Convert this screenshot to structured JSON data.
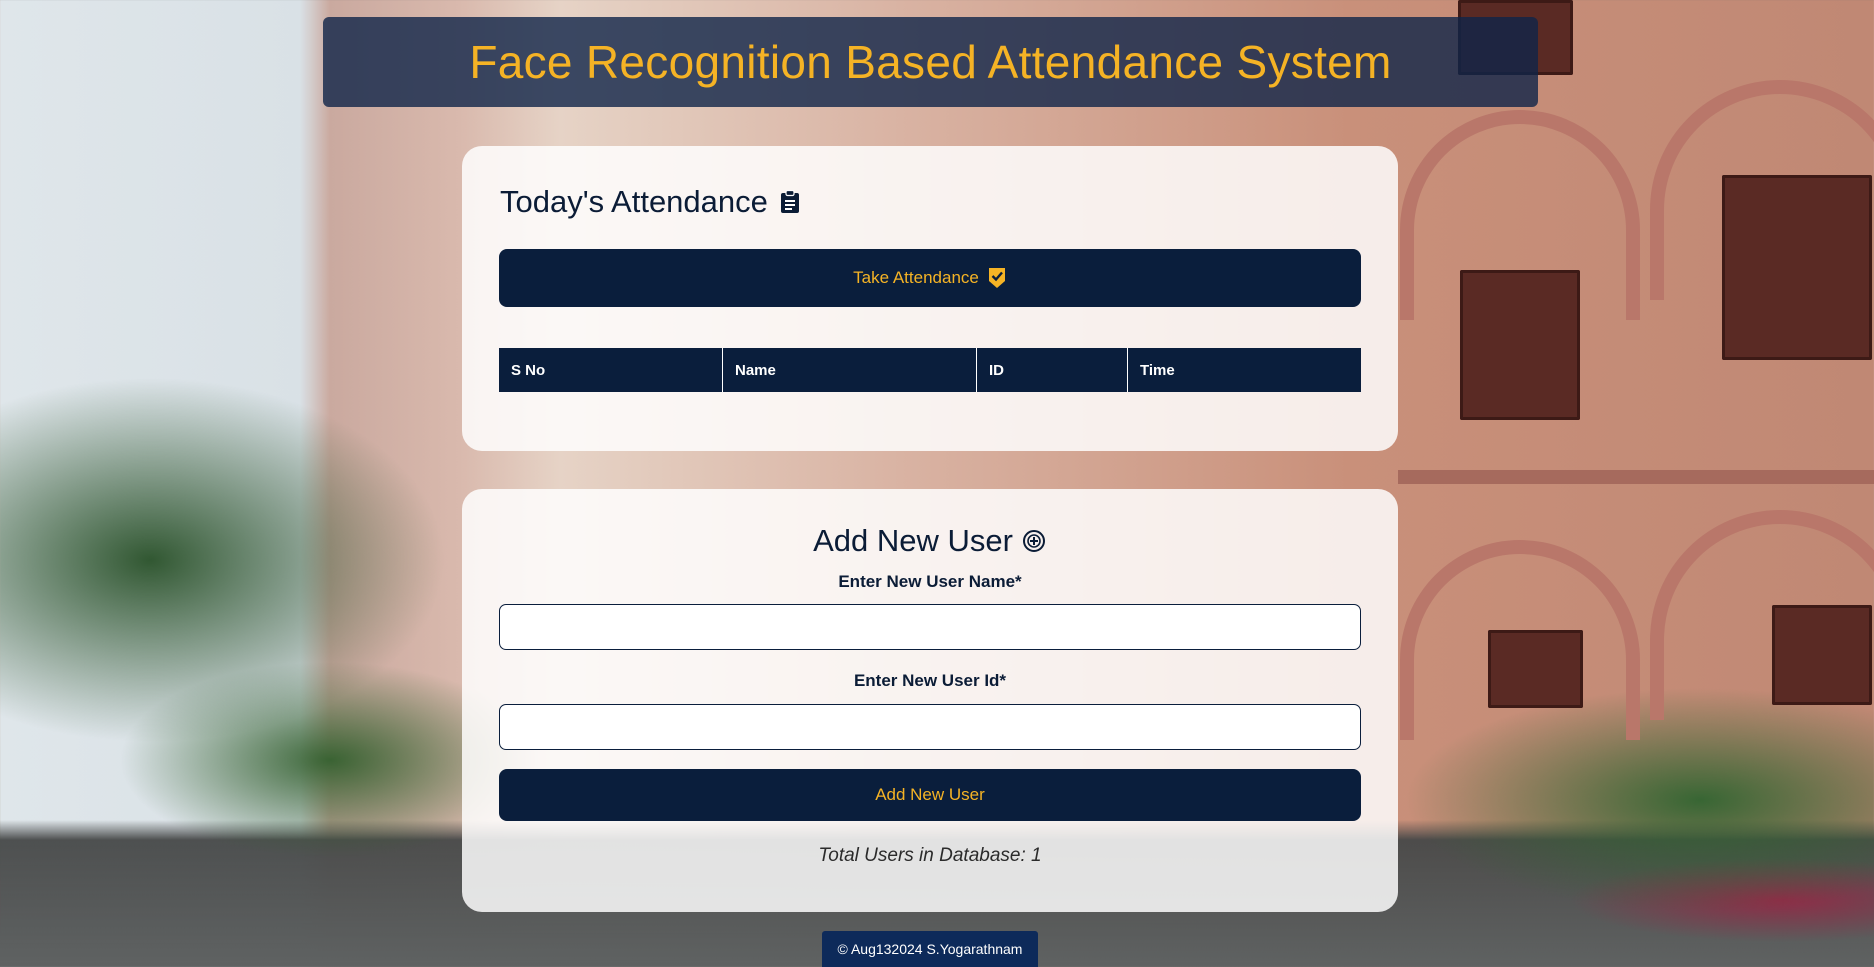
{
  "header": {
    "title": "Face Recognition Based Attendance System"
  },
  "attendance": {
    "title": "Today's Attendance",
    "title_icon": "clipboard-icon",
    "take_button_label": "Take Attendance",
    "take_button_icon": "verified-check-icon",
    "table": {
      "columns": [
        "S No",
        "Name",
        "ID",
        "Time"
      ],
      "rows": []
    }
  },
  "add_user": {
    "title": "Add New User",
    "title_icon": "add-circle-icon",
    "name_label": "Enter New User Name*",
    "name_value": "",
    "id_label": "Enter New User Id*",
    "id_value": "",
    "submit_label": "Add New User",
    "total_text": "Total Users in Database: 1"
  },
  "footer": {
    "text": "© Aug132024 S.Yogarathnam"
  },
  "colors": {
    "accent": "#f5b325",
    "navy": "#0a1e3c",
    "header_bg": "#0f2448",
    "footer_bg": "#0d2a5a"
  }
}
